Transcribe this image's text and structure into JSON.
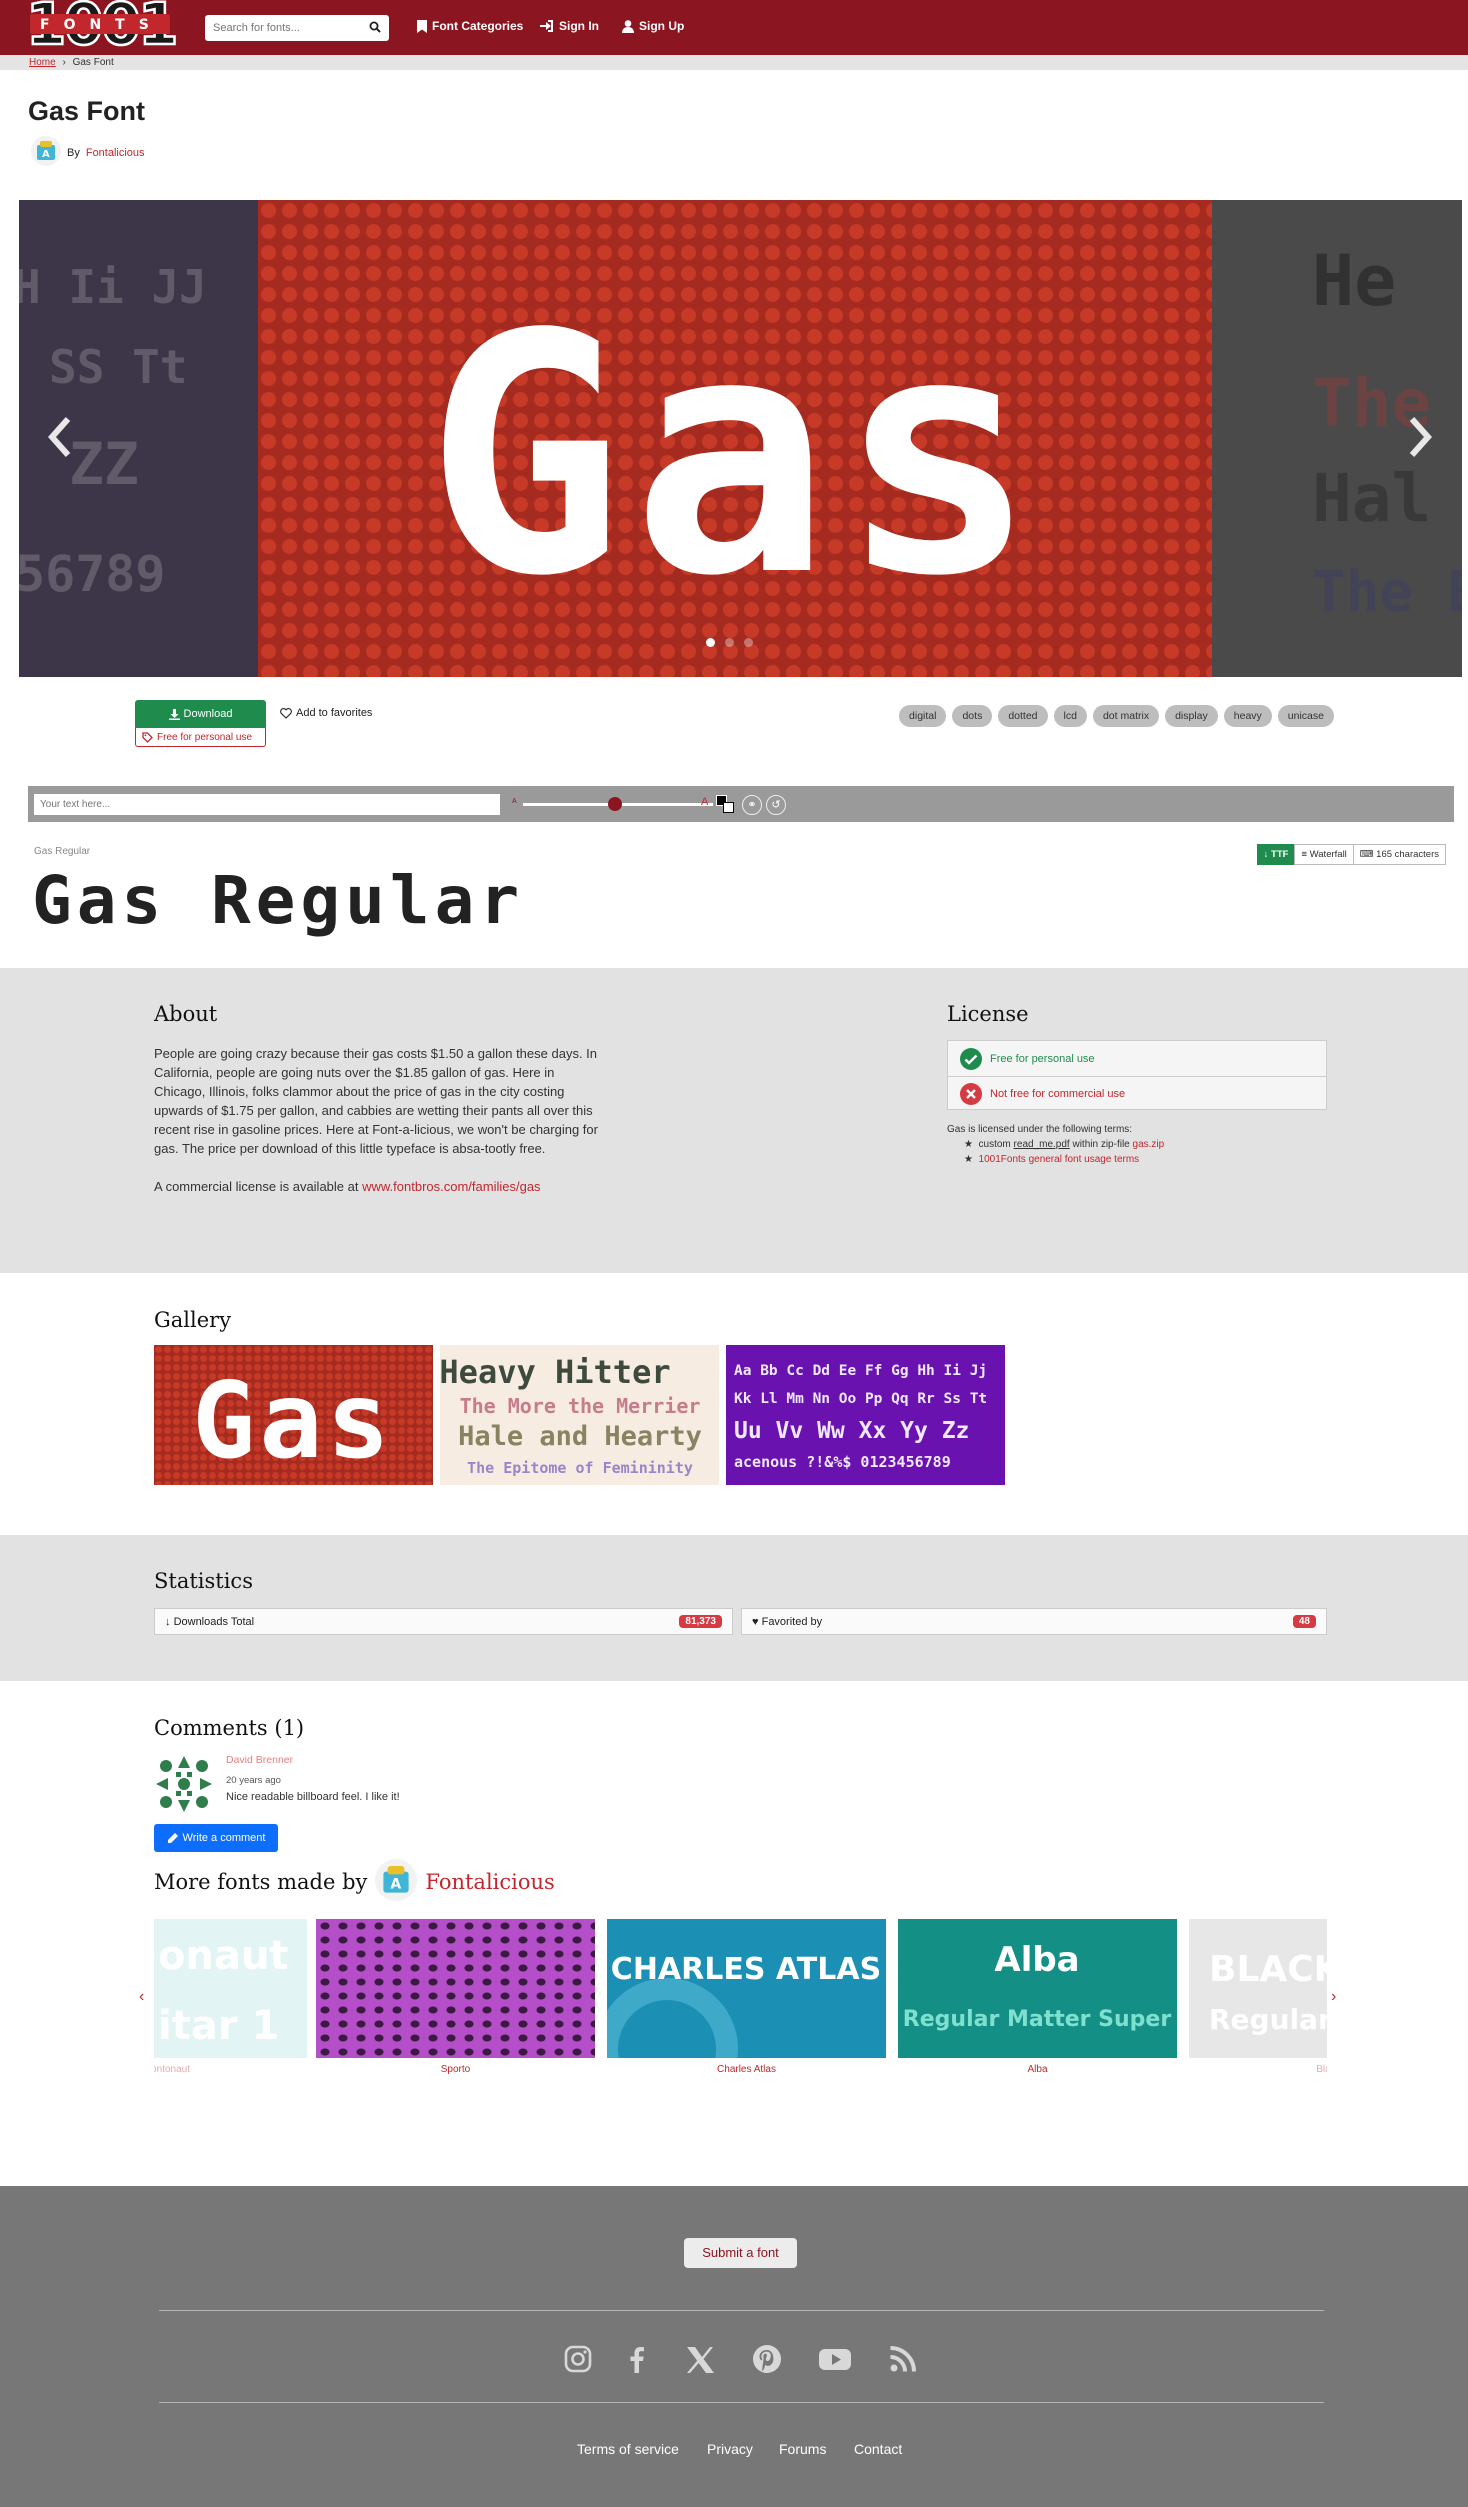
{
  "header": {
    "logo_number": "1001",
    "logo_word": "FONTS",
    "search_placeholder": "Search for fonts...",
    "nav": [
      {
        "label": "Font Categories",
        "icon": "bookmark-icon"
      },
      {
        "label": "Sign In",
        "icon": "sign-in-icon"
      },
      {
        "label": "Sign Up",
        "icon": "user-icon"
      }
    ]
  },
  "breadcrumb": {
    "home": "Home",
    "separator": "›",
    "current": "Gas Font"
  },
  "font": {
    "title": "Gas Font",
    "by_prefix": "By",
    "author": "Fontalicious"
  },
  "hero": {
    "main_text": "Gas",
    "left_ghost": [
      "H Ii JJ",
      "SS Tt",
      "ZZ",
      "56789"
    ],
    "right_ghost": [
      "He",
      "The",
      "Hal",
      "The E"
    ],
    "slide_count": 3,
    "active_slide": 1
  },
  "actions": {
    "download_label": "Download",
    "download_note": "Free for personal use",
    "favorites_label": "Add to favorites",
    "tags": [
      "digital",
      "dots",
      "dotted",
      "lcd",
      "dot matrix",
      "display",
      "heavy",
      "unicase"
    ]
  },
  "preview": {
    "text_placeholder": "Your text here...",
    "size_min_label": "A",
    "size_max_label": "A",
    "style_label": "Gas Regular",
    "style_sample": "Gas Regular",
    "format_button": "TTF",
    "waterfall_button": "Waterfall",
    "characters_button": "165 characters"
  },
  "about": {
    "heading": "About",
    "text": "People are going crazy because their gas costs $1.50 a gallon these days. In California, people are going nuts over the $1.85 gallon of gas. Here in Chicago, Illinois, folks clammor about the price of gas in the city costing upwards of $1.75 per gallon, and cabbies are wetting their pants all over this recent rise in gasoline prices. Here at Font-a-licious, we won't be charging for gas. The price per download of this little typeface is absa-tootly free.",
    "commercial_prefix": "A commercial license is available at",
    "commercial_link": "www.fontbros.com/families/gas"
  },
  "license": {
    "heading": "License",
    "personal": "Free for personal use",
    "commercial": "Not free for commercial use",
    "terms_intro": "Gas is licensed under the following terms:",
    "term1_prefix": "custom",
    "term1_file": "read_me.pdf",
    "term1_middle": "within zip-file",
    "term1_zip": "gas.zip",
    "term2": "1001Fonts general font usage terms"
  },
  "gallery": {
    "heading": "Gallery",
    "items": [
      {
        "lines": [
          "Gas"
        ]
      },
      {
        "lines": [
          "Heavy Hitter",
          "The More the Merrier",
          "Hale and Hearty",
          "The Epitome of Femininity"
        ]
      },
      {
        "lines": [
          "Aa Bb Cc Dd Ee Ff Gg Hh Ii Jj",
          "Kk Ll Mm Nn Oo Pp Qq Rr Ss Tt",
          "Uu Vv Ww Xx Yy Zz",
          "acenous ?!&%$ 0123456789"
        ]
      }
    ]
  },
  "statistics": {
    "heading": "Statistics",
    "downloads_label": "Downloads Total",
    "downloads_value": "81,373",
    "favorited_label": "Favorited by",
    "favorited_value": "48"
  },
  "comments": {
    "heading": "Comments (1)",
    "items": [
      {
        "user": "David Brenner",
        "date": "20 years ago",
        "text": "Nice readable billboard feel. I like it!"
      }
    ],
    "write_label": "Write a comment"
  },
  "more_fonts": {
    "heading_prefix": "More fonts made by",
    "author": "Fontalicious",
    "items": [
      {
        "name": "Fontonaut",
        "preview": "onaut"
      },
      {
        "name": "Sporto",
        "preview": ""
      },
      {
        "name": "Charles Atlas",
        "preview": "CHARLES ATLAS"
      },
      {
        "name": "Alba",
        "preview": "Alba"
      },
      {
        "name": "Black",
        "preview": "BLACK"
      }
    ],
    "extra_lines": {
      "card0": "itar 1",
      "card3": "Regular Matter Super",
      "card4": "Regular"
    }
  },
  "footer": {
    "submit_label": "Submit a font",
    "social": [
      "instagram-icon",
      "facebook-icon",
      "x-icon",
      "pinterest-icon",
      "youtube-icon",
      "rss-icon"
    ],
    "links": [
      "Terms of service",
      "Privacy",
      "Forums",
      "Contact"
    ]
  },
  "colors": {
    "brand": "#8b1520",
    "link": "#c1272d",
    "download": "#1f8c4e",
    "write_button": "#0d6efd",
    "badge": "#d63a43"
  }
}
